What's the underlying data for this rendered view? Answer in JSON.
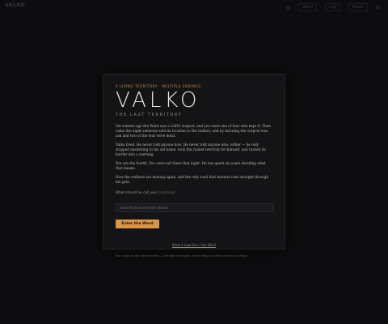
{
  "app": {
    "logo": "VALKO"
  },
  "nav": {
    "items": [
      "Ward",
      "Log",
      "Reset"
    ]
  },
  "modal": {
    "eyebrow": "A LIVING TERRITORY · MULTIPLE ENDINGS",
    "title": "VALKO",
    "subtitle": "THE LAST TERRITORY",
    "paragraphs": [
      "Six winters ago the Ward was a LADS outpost, and you were one of four who kept it. Then came the night someone sold its location to the raiders, and by morning the outpost was ash and two of the four were dead.",
      "Valko lived. He never told anyone how. He never told anyone who, either — he only stopped answering to his old name, took the ruined territory for himself, and turned its border into a warning.",
      "You are the fourth. You were not there that night. He has spent six years deciding what that means.",
      "Now the walkers are moving again, and the only road that matters runs straight through his gate."
    ],
    "input": {
      "label": "What should he call you?",
      "optional": "(optional)",
      "placeholder": "leave it blank and he'll decide",
      "value": ""
    },
    "enter_button": "Enter the Ward",
    "new_world_link": "Start a new Run / the Ward",
    "footnote": "Your choices are remembered — the Ward changes, and it keeps counting what you chose."
  },
  "colors": {
    "background": "#0d0d0f",
    "panel": "#141416",
    "accent": "#d99446",
    "eyebrow": "#c8904e"
  }
}
